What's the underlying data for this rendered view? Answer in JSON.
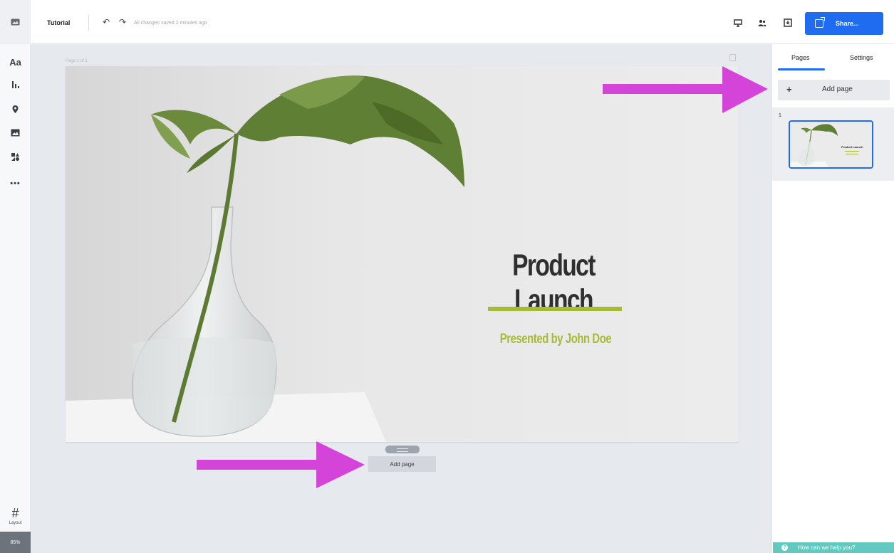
{
  "topbar": {
    "document_title": "Tutorial",
    "save_status": "All changes saved 2 minutes ago",
    "share_label": "Share..."
  },
  "leftbar": {
    "text_tool_label": "Aa",
    "layout_label": "Layout",
    "zoom_level": "85%"
  },
  "canvas": {
    "page_indicator": "Page 1 of 1",
    "slide_title": "Product Launch",
    "slide_subtitle": "Presented by John Doe",
    "add_page_label": "Add page"
  },
  "right_panel": {
    "tabs": [
      {
        "label": "Pages",
        "active": true
      },
      {
        "label": "Settings",
        "active": false
      }
    ],
    "add_page_label": "Add page",
    "pages": [
      {
        "number": "1",
        "thumb_title": "Product Launch"
      }
    ]
  },
  "help": {
    "label": "How can we help you?"
  },
  "colors": {
    "accent": "#1f6cf0",
    "slide_accent": "#a8b938",
    "annotation": "#d444d8",
    "help": "#62c9c0"
  },
  "icons": [
    "photo-icon",
    "text-icon",
    "chart-icon",
    "map-pin-icon",
    "image-icon",
    "shapes-icon",
    "more-icon",
    "grid-icon",
    "undo-icon",
    "redo-icon",
    "present-icon",
    "collaborators-icon",
    "download-icon",
    "share-icon",
    "copy-icon",
    "plus-icon",
    "help-icon"
  ]
}
